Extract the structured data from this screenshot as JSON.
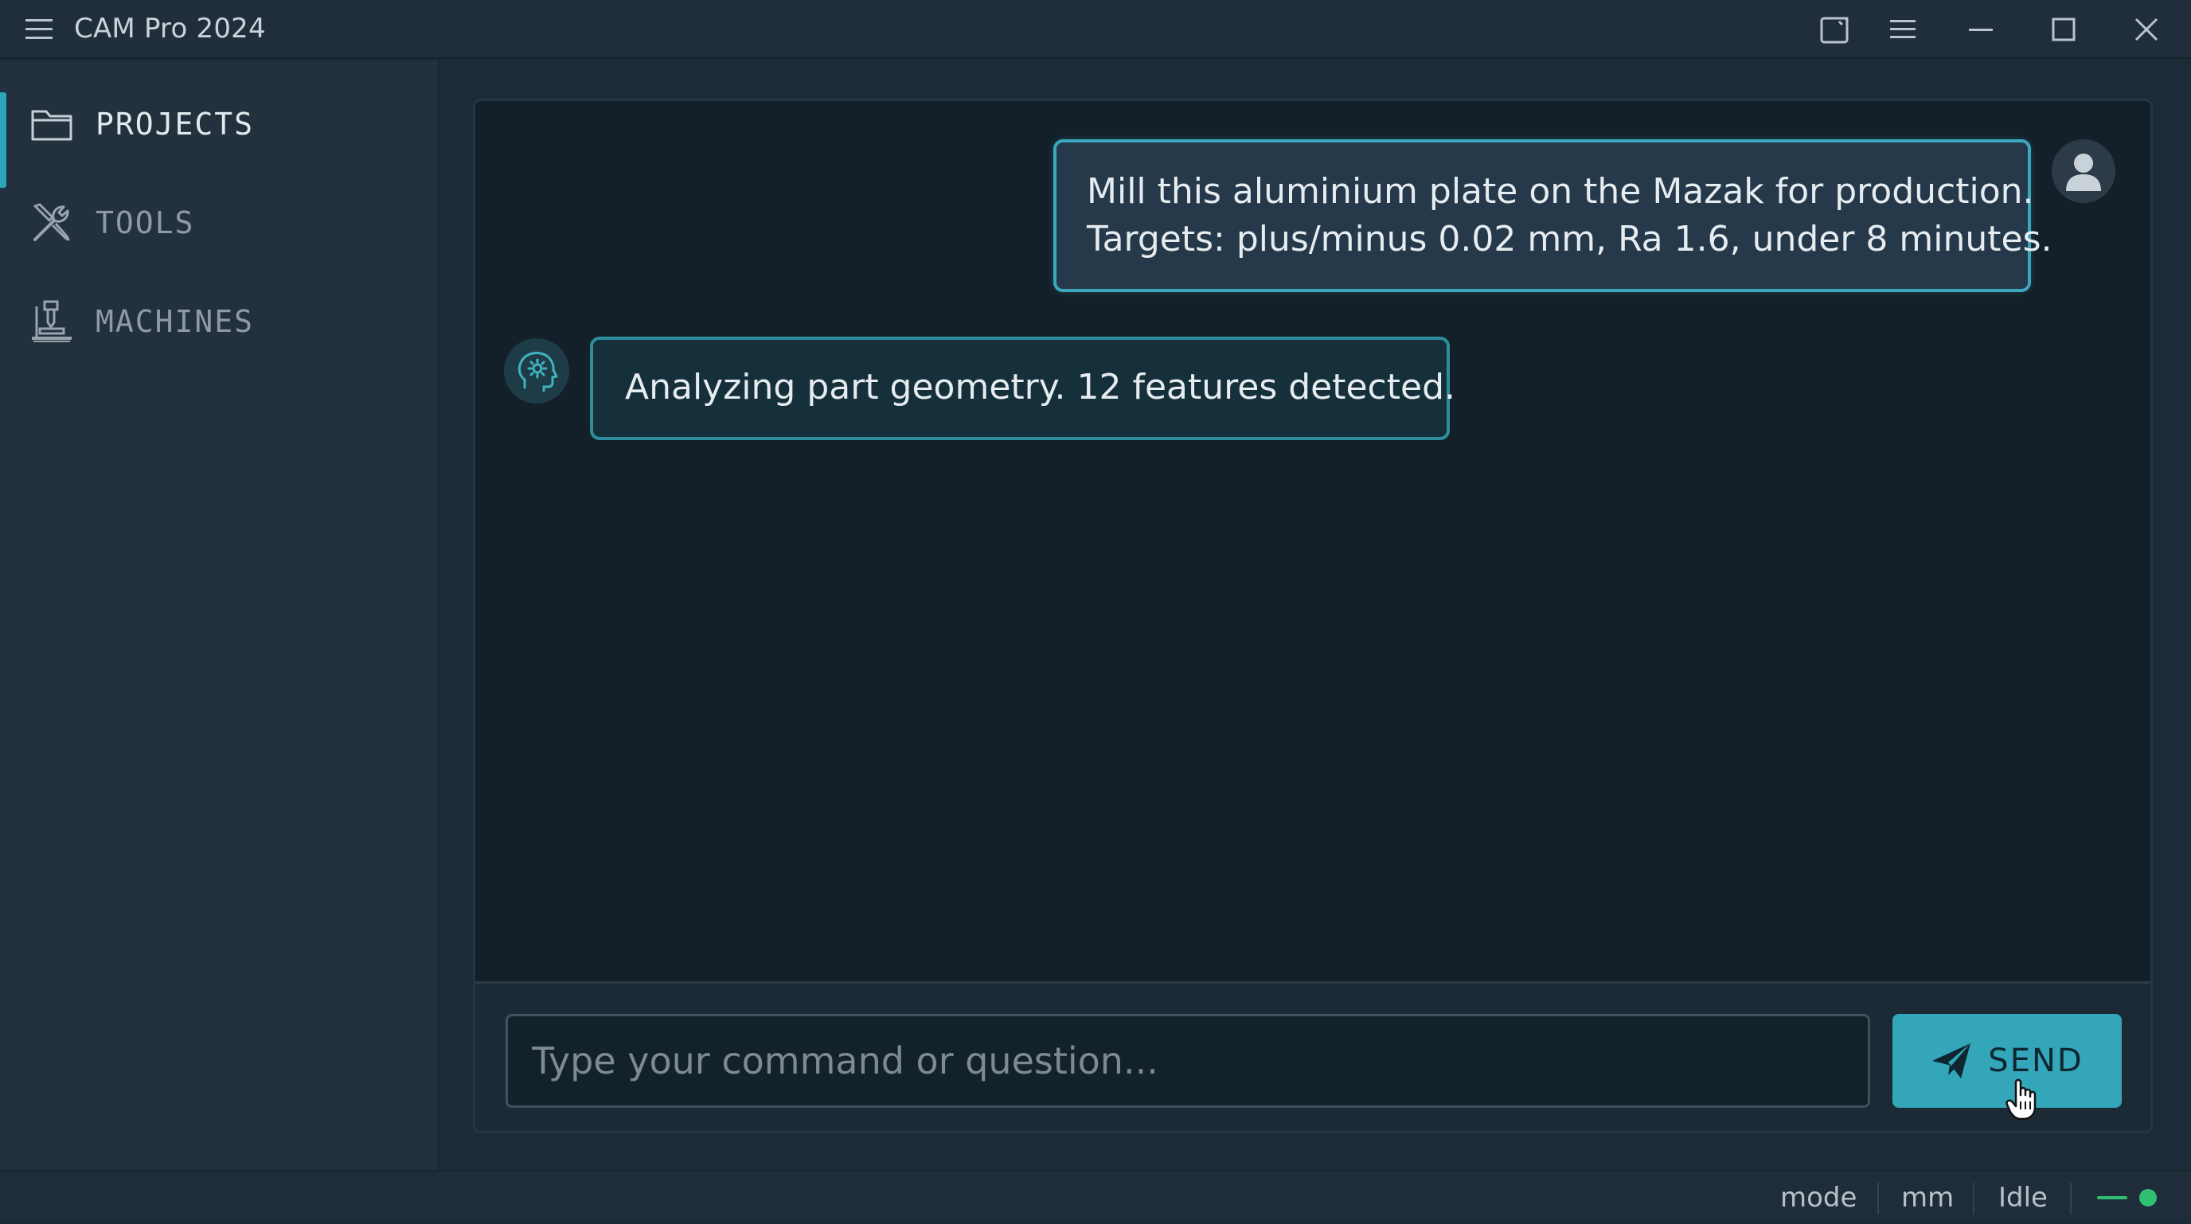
{
  "window": {
    "title": "CAM Pro 2024",
    "controls": [
      "panel-toggle",
      "menu",
      "minimize",
      "maximize",
      "close"
    ]
  },
  "sidebar": {
    "items": [
      {
        "label": "PROJECTS",
        "icon": "folder-icon",
        "active": true
      },
      {
        "label": "TOOLS",
        "icon": "tools-icon",
        "active": false
      },
      {
        "label": "MACHINES",
        "icon": "machine-icon",
        "active": false
      }
    ]
  },
  "chat": {
    "messages": [
      {
        "role": "user",
        "lines": [
          "Mill this aluminium plate on the Mazak for production.",
          "Targets: plus/minus 0.02 mm, Ra 1.6, under 8 minutes."
        ]
      },
      {
        "role": "assistant",
        "lines": [
          "Analyzing part geometry. 12 features detected."
        ]
      }
    ],
    "input": {
      "placeholder": "Type your command or question...",
      "value": ""
    },
    "send_label": "SEND"
  },
  "statusbar": {
    "mode": "mode",
    "units": "mm",
    "state": "Idle",
    "connection_color": "#2fbf71"
  },
  "colors": {
    "accent": "#33a6b9",
    "background": "#1b2b37",
    "chat_background": "#142029"
  }
}
